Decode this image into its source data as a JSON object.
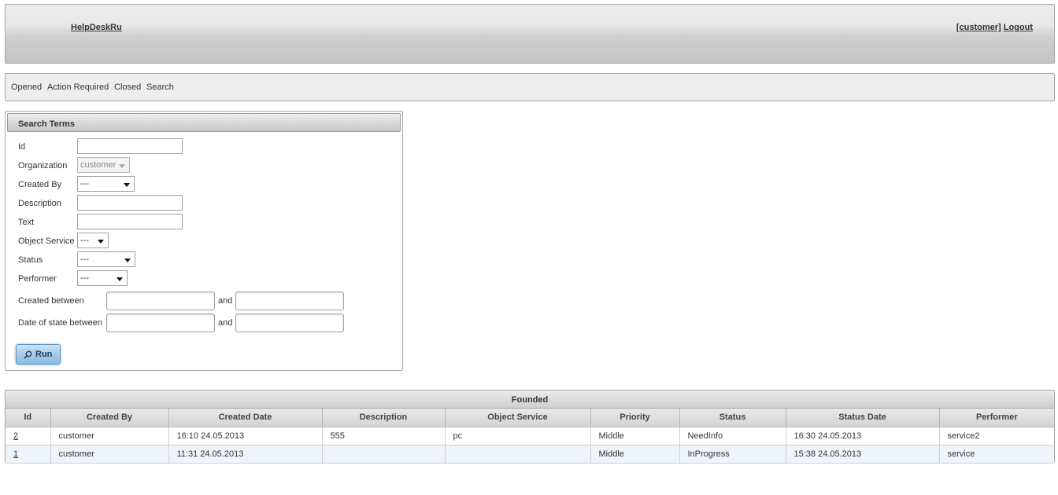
{
  "header": {
    "brand": "HelpDeskRu",
    "user": "[customer]",
    "logout": "Logout"
  },
  "nav": {
    "items": [
      "Opened",
      "Action Required",
      "Closed",
      "Search"
    ]
  },
  "search": {
    "title": "Search Terms",
    "labels": {
      "id": "Id",
      "organization": "Organization",
      "created_by": "Created By",
      "description": "Description",
      "text": "Text",
      "object_service": "Object Service",
      "status": "Status",
      "performer": "Performer",
      "created_between": "Created between",
      "date_of_state_between": "Date of state between",
      "and": "and"
    },
    "values": {
      "organization": "customer",
      "created_by": "---",
      "object_service": "---",
      "status": "---",
      "performer": "---"
    },
    "run_label": "Run"
  },
  "results": {
    "title": "Founded",
    "columns": [
      "Id",
      "Created By",
      "Created Date",
      "Description",
      "Object Service",
      "Priority",
      "Status",
      "Status Date",
      "Performer"
    ],
    "rows": [
      [
        "2",
        "customer",
        "16:10 24.05.2013",
        "555",
        "pc",
        "Middle",
        "NeedInfo",
        "16:30 24.05.2013",
        "service2"
      ],
      [
        "1",
        "customer",
        "11:31 24.05.2013",
        "",
        "",
        "Middle",
        "InProgress",
        "15:38 24.05.2013",
        "service"
      ]
    ]
  }
}
